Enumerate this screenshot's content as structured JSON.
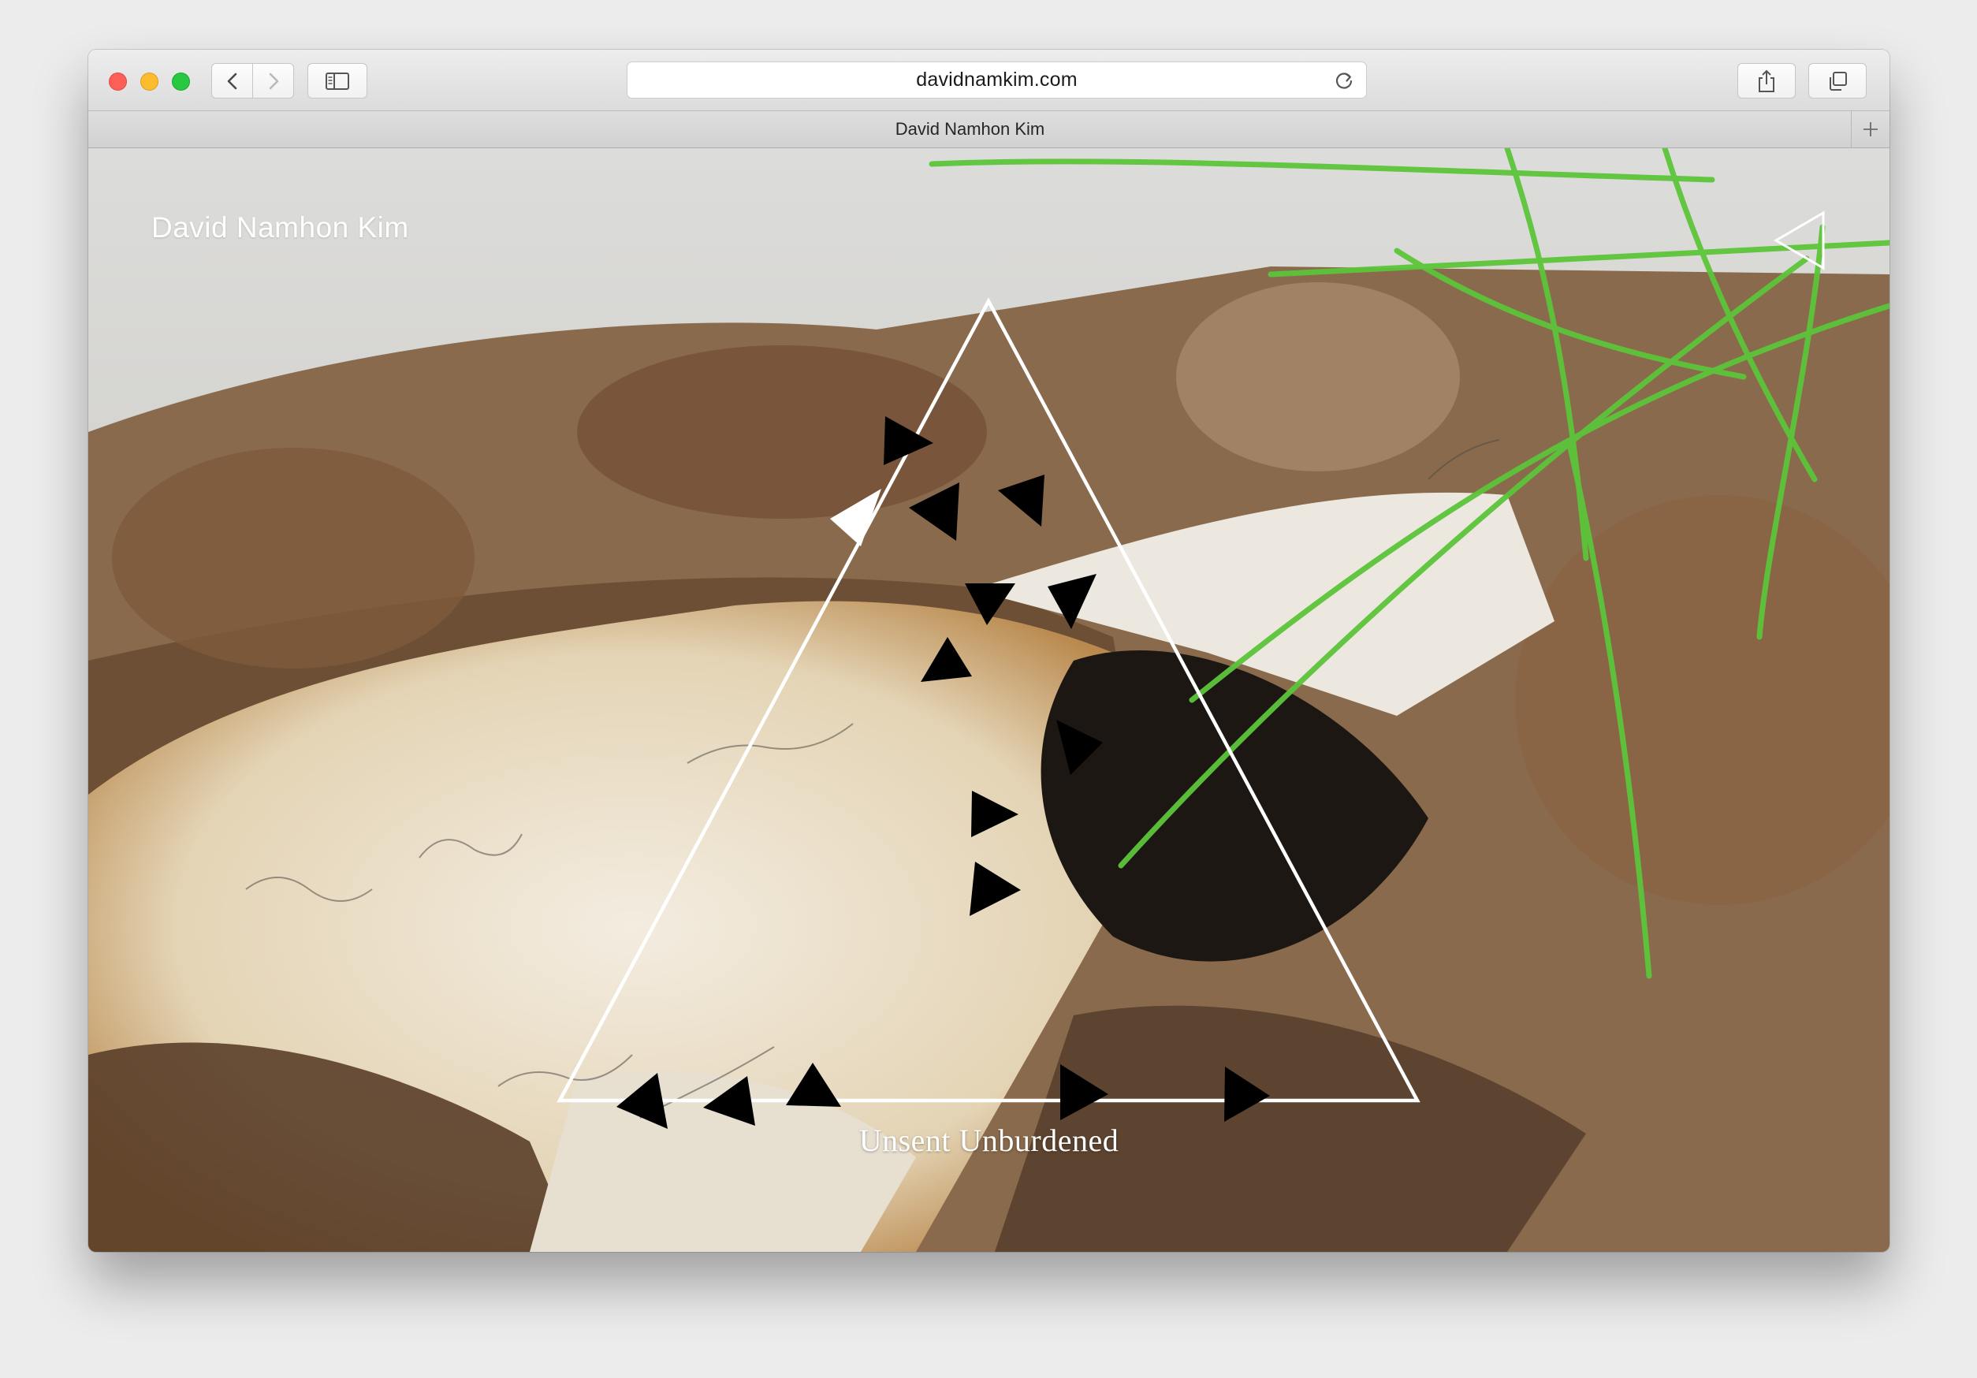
{
  "browser": {
    "url": "davidnamkim.com",
    "tab_title": "David Namhon Kim",
    "icons": {
      "back": "chevron-left-icon",
      "forward": "chevron-right-icon",
      "sidebar": "sidebar-icon",
      "reload": "reload-icon",
      "share": "share-icon",
      "tabs": "tabs-overview-icon",
      "new_tab": "plus-icon"
    },
    "colors": {
      "close": "#fc5f57",
      "minimize": "#fdbc2e",
      "maximize": "#28c840"
    }
  },
  "page": {
    "site_title": "David Namhon Kim",
    "caption": "Unsent Unburdened",
    "menu_icon": "triangle-left-outline-icon",
    "artwork": "outlined-white-triangle-with-scattered-black-arrowheads",
    "background": "photo of burnt handwritten paper among dry leaves and green grass"
  }
}
